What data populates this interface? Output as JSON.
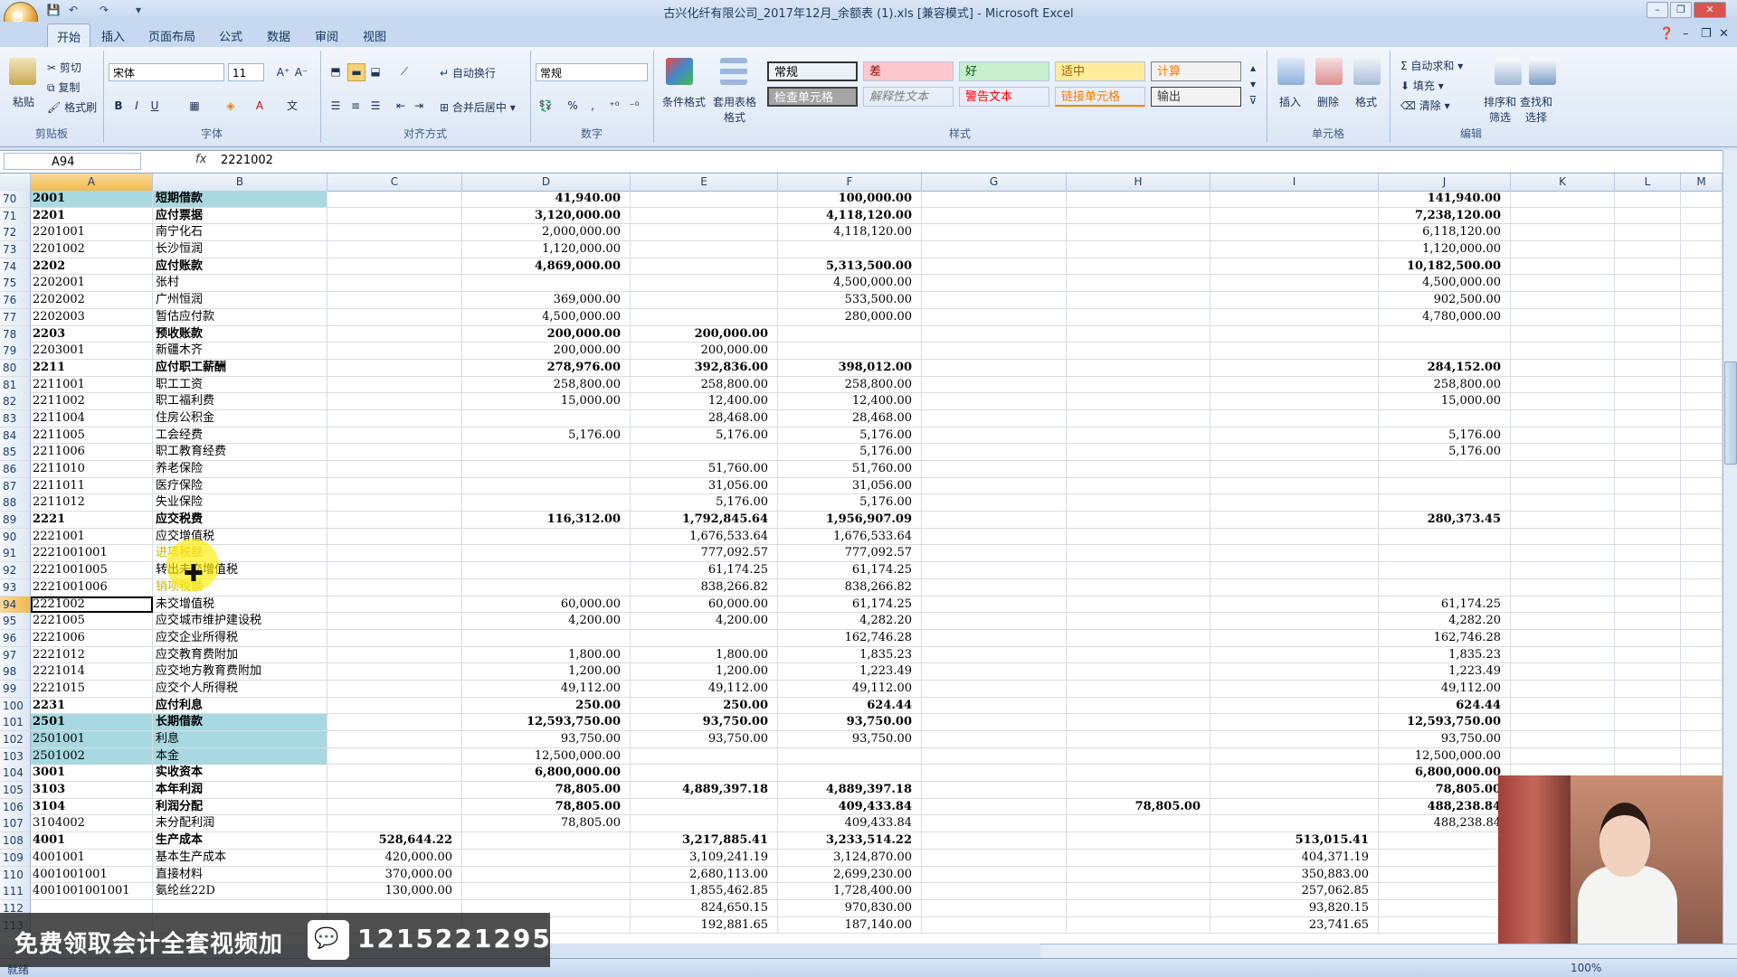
{
  "window": {
    "title": "古兴化纤有限公司_2017年12月_余额表 (1).xls  [兼容模式] - Microsoft Excel"
  },
  "tabs": [
    "开始",
    "插入",
    "页面布局",
    "公式",
    "数据",
    "审阅",
    "视图"
  ],
  "ribbon": {
    "clipboard": {
      "paste": "粘贴",
      "cut": "剪切",
      "copy": "复制",
      "format_painter": "格式刷",
      "label": "剪贴板"
    },
    "font": {
      "name": "宋体",
      "size": "11",
      "label": "字体"
    },
    "alignment": {
      "wrap": "自动换行",
      "merge": "合并后居中",
      "label": "对齐方式"
    },
    "number": {
      "format": "常规",
      "label": "数字"
    },
    "styles": {
      "conditional": "条件格式",
      "table": "套用表格格式",
      "label": "样式",
      "cells": [
        {
          "text": "常规",
          "bg": "#ffffff",
          "fg": "#000000"
        },
        {
          "text": "差",
          "bg": "#ffc7ce",
          "fg": "#9c0006"
        },
        {
          "text": "好",
          "bg": "#c6efce",
          "fg": "#006100"
        },
        {
          "text": "适中",
          "bg": "#ffeb9c",
          "fg": "#9c6500"
        },
        {
          "text": "计算",
          "bg": "#f2f2f2",
          "fg": "#fa7d00"
        },
        {
          "text": "检查单元格",
          "bg": "#a5a5a5",
          "fg": "#ffffff"
        },
        {
          "text": "解释性文本",
          "bg": "#ffffff",
          "fg": "#7f7f7f"
        },
        {
          "text": "警告文本",
          "bg": "#ffffff",
          "fg": "#ff0000"
        },
        {
          "text": "链接单元格",
          "bg": "#ffffff",
          "fg": "#fa7d00"
        },
        {
          "text": "输出",
          "bg": "#f2f2f2",
          "fg": "#3f3f3f"
        }
      ]
    },
    "cells_group": {
      "insert": "插入",
      "delete": "删除",
      "format": "格式",
      "label": "单元格"
    },
    "editing": {
      "autosum": "自动求和",
      "fill": "填充",
      "clear": "清除",
      "sort": "排序和筛选",
      "find": "查找和选择",
      "label": "编辑"
    }
  },
  "formula_bar": {
    "name_box": "A94",
    "fx": "fx",
    "formula": "2221002"
  },
  "columns": [
    "A",
    "B",
    "C",
    "D",
    "E",
    "F",
    "G",
    "H",
    "I",
    "J",
    "K",
    "L",
    "M"
  ],
  "rows": [
    {
      "n": "70",
      "a": "2001",
      "b": "短期借款",
      "c": "",
      "d": "41,940.00",
      "e": "",
      "f": "100,000.00",
      "h": "",
      "i": "",
      "j": "141,940.00",
      "bold": true,
      "teal": true
    },
    {
      "n": "71",
      "a": "2201",
      "b": "应付票据",
      "c": "",
      "d": "3,120,000.00",
      "e": "",
      "f": "4,118,120.00",
      "h": "",
      "i": "",
      "j": "7,238,120.00",
      "bold": true
    },
    {
      "n": "72",
      "a": "2201001",
      "b": "南宁化石",
      "c": "",
      "d": "2,000,000.00",
      "e": "",
      "f": "4,118,120.00",
      "h": "",
      "i": "",
      "j": "6,118,120.00"
    },
    {
      "n": "73",
      "a": "2201002",
      "b": "长沙恒润",
      "c": "",
      "d": "1,120,000.00",
      "e": "",
      "f": "",
      "h": "",
      "i": "",
      "j": "1,120,000.00"
    },
    {
      "n": "74",
      "a": "2202",
      "b": "应付账款",
      "c": "",
      "d": "4,869,000.00",
      "e": "",
      "f": "5,313,500.00",
      "h": "",
      "i": "",
      "j": "10,182,500.00",
      "bold": true
    },
    {
      "n": "75",
      "a": "2202001",
      "b": "张村",
      "c": "",
      "d": "",
      "e": "",
      "f": "4,500,000.00",
      "h": "",
      "i": "",
      "j": "4,500,000.00"
    },
    {
      "n": "76",
      "a": "2202002",
      "b": "广州恒润",
      "c": "",
      "d": "369,000.00",
      "e": "",
      "f": "533,500.00",
      "h": "",
      "i": "",
      "j": "902,500.00"
    },
    {
      "n": "77",
      "a": "2202003",
      "b": "暂估应付款",
      "c": "",
      "d": "4,500,000.00",
      "e": "",
      "f": "280,000.00",
      "h": "",
      "i": "",
      "j": "4,780,000.00"
    },
    {
      "n": "78",
      "a": "2203",
      "b": "预收账款",
      "c": "",
      "d": "200,000.00",
      "e": "200,000.00",
      "f": "",
      "h": "",
      "i": "",
      "j": "",
      "bold": true
    },
    {
      "n": "79",
      "a": "2203001",
      "b": "新疆木齐",
      "c": "",
      "d": "200,000.00",
      "e": "200,000.00",
      "f": "",
      "h": "",
      "i": "",
      "j": ""
    },
    {
      "n": "80",
      "a": "2211",
      "b": "应付职工薪酬",
      "c": "",
      "d": "278,976.00",
      "e": "392,836.00",
      "f": "398,012.00",
      "h": "",
      "i": "",
      "j": "284,152.00",
      "bold": true
    },
    {
      "n": "81",
      "a": "2211001",
      "b": "职工工资",
      "c": "",
      "d": "258,800.00",
      "e": "258,800.00",
      "f": "258,800.00",
      "h": "",
      "i": "",
      "j": "258,800.00"
    },
    {
      "n": "82",
      "a": "2211002",
      "b": "职工福利费",
      "c": "",
      "d": "15,000.00",
      "e": "12,400.00",
      "f": "12,400.00",
      "h": "",
      "i": "",
      "j": "15,000.00"
    },
    {
      "n": "83",
      "a": "2211004",
      "b": "住房公积金",
      "c": "",
      "d": "",
      "e": "28,468.00",
      "f": "28,468.00",
      "h": "",
      "i": "",
      "j": ""
    },
    {
      "n": "84",
      "a": "2211005",
      "b": "工会经费",
      "c": "",
      "d": "5,176.00",
      "e": "5,176.00",
      "f": "5,176.00",
      "h": "",
      "i": "",
      "j": "5,176.00"
    },
    {
      "n": "85",
      "a": "2211006",
      "b": "职工教育经费",
      "c": "",
      "d": "",
      "e": "",
      "f": "5,176.00",
      "h": "",
      "i": "",
      "j": "5,176.00"
    },
    {
      "n": "86",
      "a": "2211010",
      "b": "养老保险",
      "c": "",
      "d": "",
      "e": "51,760.00",
      "f": "51,760.00",
      "h": "",
      "i": "",
      "j": ""
    },
    {
      "n": "87",
      "a": "2211011",
      "b": "医疗保险",
      "c": "",
      "d": "",
      "e": "31,056.00",
      "f": "31,056.00",
      "h": "",
      "i": "",
      "j": ""
    },
    {
      "n": "88",
      "a": "2211012",
      "b": "失业保险",
      "c": "",
      "d": "",
      "e": "5,176.00",
      "f": "5,176.00",
      "h": "",
      "i": "",
      "j": ""
    },
    {
      "n": "89",
      "a": "2221",
      "b": "应交税费",
      "c": "",
      "d": "116,312.00",
      "e": "1,792,845.64",
      "f": "1,956,907.09",
      "h": "",
      "i": "",
      "j": "280,373.45",
      "bold": true
    },
    {
      "n": "90",
      "a": "2221001",
      "b": "应交增值税",
      "c": "",
      "d": "",
      "e": "1,676,533.64",
      "f": "1,676,533.64",
      "h": "",
      "i": "",
      "j": ""
    },
    {
      "n": "91",
      "a": "2221001001",
      "b": "进项税额",
      "c": "",
      "d": "",
      "e": "777,092.57",
      "f": "777,092.57",
      "h": "",
      "i": "",
      "j": "",
      "yellow": true
    },
    {
      "n": "92",
      "a": "2221001005",
      "b": "转出未交增值税",
      "c": "",
      "d": "",
      "e": "61,174.25",
      "f": "61,174.25",
      "h": "",
      "i": "",
      "j": ""
    },
    {
      "n": "93",
      "a": "2221001006",
      "b": "销项税额",
      "c": "",
      "d": "",
      "e": "838,266.82",
      "f": "838,266.82",
      "h": "",
      "i": "",
      "j": "",
      "yellow": true
    },
    {
      "n": "94",
      "a": "2221002",
      "b": "未交增值税",
      "c": "",
      "d": "60,000.00",
      "e": "60,000.00",
      "f": "61,174.25",
      "h": "",
      "i": "",
      "j": "61,174.25",
      "active": true
    },
    {
      "n": "95",
      "a": "2221005",
      "b": "应交城市维护建设税",
      "c": "",
      "d": "4,200.00",
      "e": "4,200.00",
      "f": "4,282.20",
      "h": "",
      "i": "",
      "j": "4,282.20"
    },
    {
      "n": "96",
      "a": "2221006",
      "b": "应交企业所得税",
      "c": "",
      "d": "",
      "e": "",
      "f": "162,746.28",
      "h": "",
      "i": "",
      "j": "162,746.28"
    },
    {
      "n": "97",
      "a": "2221012",
      "b": "应交教育费附加",
      "c": "",
      "d": "1,800.00",
      "e": "1,800.00",
      "f": "1,835.23",
      "h": "",
      "i": "",
      "j": "1,835.23"
    },
    {
      "n": "98",
      "a": "2221014",
      "b": "应交地方教育费附加",
      "c": "",
      "d": "1,200.00",
      "e": "1,200.00",
      "f": "1,223.49",
      "h": "",
      "i": "",
      "j": "1,223.49"
    },
    {
      "n": "99",
      "a": "2221015",
      "b": "应交个人所得税",
      "c": "",
      "d": "49,112.00",
      "e": "49,112.00",
      "f": "49,112.00",
      "h": "",
      "i": "",
      "j": "49,112.00"
    },
    {
      "n": "100",
      "a": "2231",
      "b": "应付利息",
      "c": "",
      "d": "250.00",
      "e": "250.00",
      "f": "624.44",
      "h": "",
      "i": "",
      "j": "624.44",
      "bold": true
    },
    {
      "n": "101",
      "a": "2501",
      "b": "长期借款",
      "c": "",
      "d": "12,593,750.00",
      "e": "93,750.00",
      "f": "93,750.00",
      "h": "",
      "i": "",
      "j": "12,593,750.00",
      "bold": true,
      "teal": true
    },
    {
      "n": "102",
      "a": "2501001",
      "b": "利息",
      "c": "",
      "d": "93,750.00",
      "e": "93,750.00",
      "f": "93,750.00",
      "h": "",
      "i": "",
      "j": "93,750.00",
      "teal": true
    },
    {
      "n": "103",
      "a": "2501002",
      "b": "本金",
      "c": "",
      "d": "12,500,000.00",
      "e": "",
      "f": "",
      "h": "",
      "i": "",
      "j": "12,500,000.00",
      "teal": true
    },
    {
      "n": "104",
      "a": "3001",
      "b": "实收资本",
      "c": "",
      "d": "6,800,000.00",
      "e": "",
      "f": "",
      "h": "",
      "i": "",
      "j": "6,800,000.00",
      "bold": true
    },
    {
      "n": "105",
      "a": "3103",
      "b": "本年利润",
      "c": "",
      "d": "78,805.00",
      "e": "4,889,397.18",
      "f": "4,889,397.18",
      "h": "",
      "i": "",
      "j": "78,805.00",
      "bold": true
    },
    {
      "n": "106",
      "a": "3104",
      "b": "利润分配",
      "c": "",
      "d": "78,805.00",
      "e": "",
      "f": "409,433.84",
      "h": "78,805.00",
      "i": "",
      "j": "488,238.84",
      "bold": true
    },
    {
      "n": "107",
      "a": "3104002",
      "b": "未分配利润",
      "c": "",
      "d": "78,805.00",
      "e": "",
      "f": "409,433.84",
      "h": "",
      "i": "",
      "j": "488,238.84"
    },
    {
      "n": "108",
      "a": "4001",
      "b": "生产成本",
      "c": "528,644.22",
      "d": "",
      "e": "3,217,885.41",
      "f": "3,233,514.22",
      "h": "",
      "i": "513,015.41",
      "j": "",
      "bold": true
    },
    {
      "n": "109",
      "a": "4001001",
      "b": "基本生产成本",
      "c": "420,000.00",
      "d": "",
      "e": "3,109,241.19",
      "f": "3,124,870.00",
      "h": "",
      "i": "404,371.19",
      "j": ""
    },
    {
      "n": "110",
      "a": "4001001001",
      "b": "直接材料",
      "c": "370,000.00",
      "d": "",
      "e": "2,680,113.00",
      "f": "2,699,230.00",
      "h": "",
      "i": "350,883.00",
      "j": ""
    },
    {
      "n": "111",
      "a": "4001001001001",
      "b": "氨纶丝22D",
      "c": "130,000.00",
      "d": "",
      "e": "1,855,462.85",
      "f": "1,728,400.00",
      "h": "",
      "i": "257,062.85",
      "j": ""
    },
    {
      "n": "112",
      "a": "",
      "b": "",
      "c": "",
      "d": "",
      "e": "824,650.15",
      "f": "970,830.00",
      "h": "",
      "i": "93,820.15",
      "j": ""
    },
    {
      "n": "113",
      "a": "",
      "b": "",
      "c": "",
      "d": "",
      "e": "192,881.65",
      "f": "187,140.00",
      "h": "",
      "i": "23,741.65",
      "j": ""
    }
  ],
  "status": {
    "ready": "就绪",
    "zoom": "100%"
  },
  "banner": {
    "text": "免费领取会计全套视频加",
    "number": "1215221295"
  },
  "colors": {
    "teal": "#a8d8e0",
    "highlight": "#ffec00",
    "selected_header": "#f0b94e"
  }
}
